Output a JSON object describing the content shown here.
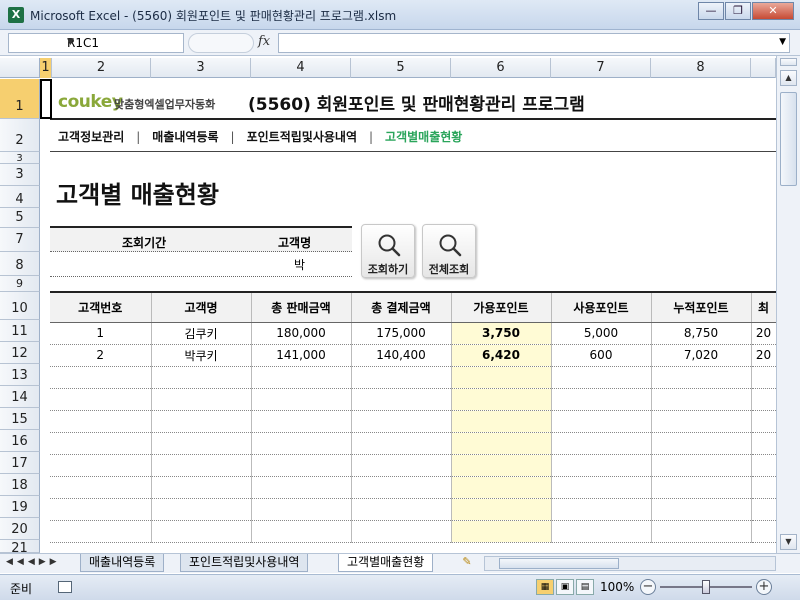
{
  "window": {
    "app_icon": "X",
    "title": "Microsoft Excel - (5560) 회원포인트 및 판매현황관리 프로그램.xlsm",
    "minimize": "—",
    "restore": "❐",
    "close": "✕"
  },
  "formula_bar": {
    "name_box": "R1C1",
    "fx": "fx",
    "formula": ""
  },
  "columns": [
    "1",
    "2",
    "3",
    "4",
    "5",
    "6",
    "7",
    "8"
  ],
  "rows": [
    "1",
    "2",
    "3",
    "4",
    "5",
    "7",
    "8",
    "10",
    "11",
    "12",
    "13",
    "14",
    "15",
    "16",
    "17",
    "18",
    "19",
    "20",
    "21"
  ],
  "header": {
    "logo_main": "coukey",
    "logo_sub": "맞춤형엑셀업무자동화",
    "app_title": "(5560) 회원포인트 및 판매현황관리 프로그램"
  },
  "nav": {
    "items": [
      "고객정보관리",
      "매출내역등록",
      "포인트적립및사용내역",
      "고객별매출현황"
    ],
    "separator": "|",
    "active_index": 3
  },
  "page_title": "고객별 매출현황",
  "search": {
    "period_label": "조회기간",
    "name_label": "고객명",
    "name_value": "박",
    "search_button": "조회하기",
    "all_button": "전체조회"
  },
  "table": {
    "headers": [
      "고객번호",
      "고객명",
      "총 판매금액",
      "총 결제금액",
      "가용포인트",
      "사용포인트",
      "누적포인트",
      "최"
    ],
    "rows": [
      [
        "1",
        "김쿠키",
        "180,000",
        "175,000",
        "3,750",
        "5,000",
        "8,750",
        "20"
      ],
      [
        "2",
        "박쿠키",
        "141,000",
        "140,400",
        "6,420",
        "600",
        "7,020",
        "20"
      ]
    ]
  },
  "sheet_tabs": {
    "nav": "◀◀◀▶▶",
    "tabs": [
      "매출내역등록",
      "포인트적립및사용내역",
      "고객별매출현황"
    ],
    "active_index": 2
  },
  "status": {
    "ready": "준비",
    "zoom": "100%",
    "zoom_level_percent": 100
  },
  "colors": {
    "accent_green": "#2aa55b",
    "highlight_column": "#fffbd5",
    "selection": "#f6cf6f"
  }
}
